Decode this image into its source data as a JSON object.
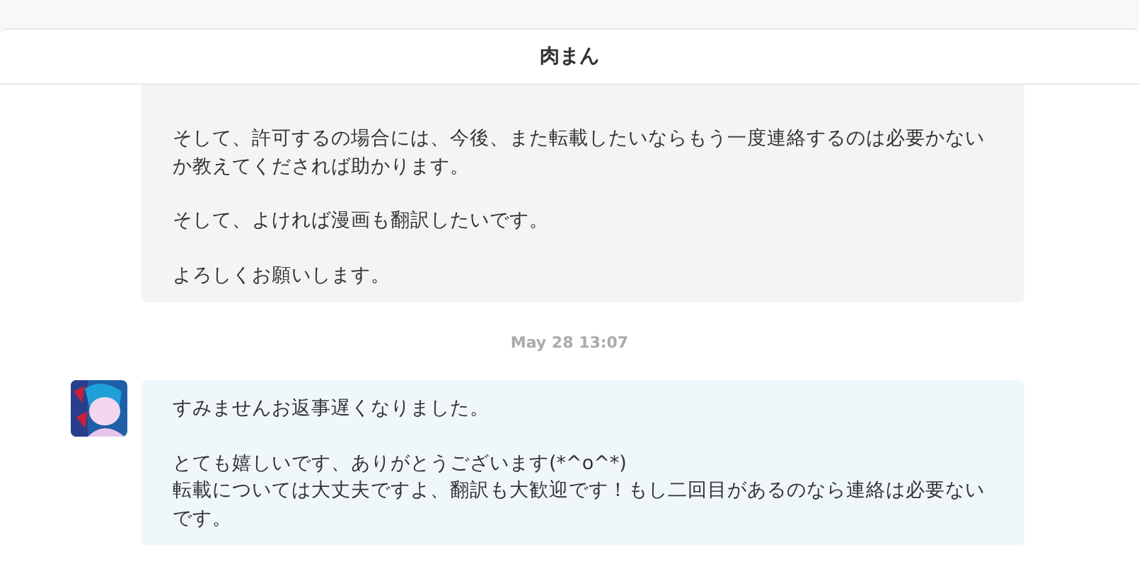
{
  "header": {
    "title": "肉まん"
  },
  "messages": [
    {
      "kind": "outgoing",
      "paragraphs": [
        [
          "そして、許可するの場合には、今後、また転載したいならもう一度連絡するのは必要かない",
          "か教えてくだされば助かります。"
        ],
        [
          "そして、よければ漫画も翻訳したいです。"
        ],
        [
          "よろしくお願いします。"
        ]
      ]
    },
    {
      "kind": "timestamp",
      "text": "May 28 13:07"
    },
    {
      "kind": "incoming",
      "paragraphs": [
        [
          "すみませんお返事遅くなりました。"
        ],
        [
          "とても嬉しいです、ありがとうございます(*^o^*)",
          "転載については大丈夫ですよ、翻訳も大歓迎です！もし二回目があるのなら連絡は必要ない",
          "です。"
        ]
      ]
    }
  ]
}
